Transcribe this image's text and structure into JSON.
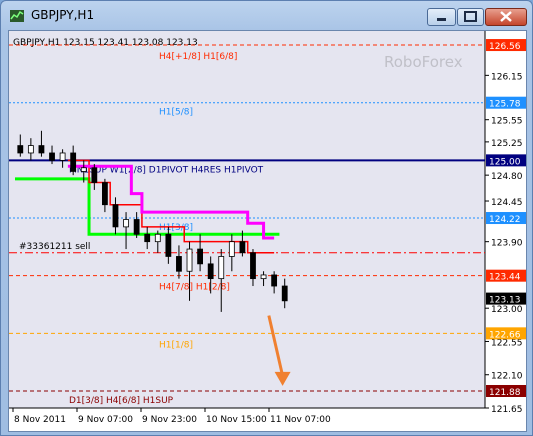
{
  "window": {
    "title": "GBPJPY,H1"
  },
  "chart": {
    "header": "GBPJPY,H1  123.15 123.41 123.08 123.13",
    "watermark": "RoboForex",
    "colors": {
      "background": "#e5e5f0",
      "candles": "#000000",
      "green_line": "#00ff00",
      "magenta_line": "#ff00ff",
      "red_line": "#ff0000",
      "arrow": "#f08030"
    }
  },
  "chart_data": {
    "type": "candlestick",
    "symbol": "GBPJPY",
    "timeframe": "H1",
    "ohlc_last": {
      "open": 123.15,
      "high": 123.41,
      "low": 123.08,
      "close": 123.13
    },
    "ylim": [
      121.65,
      126.75
    ],
    "y_ticks": [
      "126.15",
      "125.55",
      "125.25",
      "124.80",
      "124.45",
      "123.90",
      "123.00",
      "122.55",
      "122.10",
      "121.65"
    ],
    "x_ticks": [
      "8 Nov 2011",
      "9 Nov 07:00",
      "9 Nov 23:00",
      "10 Nov 15:00",
      "11 Nov 07:00"
    ],
    "levels": [
      {
        "label": "H4[+1/8] H1[6/8]",
        "price": 126.56,
        "price_label": "126.56",
        "color": "#ff2a00",
        "style": "dashed"
      },
      {
        "label": "H1[5/8]",
        "price": 125.78,
        "price_label": "125.78",
        "color": "#1e90ff",
        "style": "dotted"
      },
      {
        "label": "MN1SUP W1[2/8] D1PIVOT H4RES H1PIVOT",
        "price": 125.0,
        "price_label": "125.00",
        "color": "#000080",
        "style": "solid"
      },
      {
        "label": "H1[3/8]",
        "price": 124.22,
        "price_label": "124.22",
        "color": "#1e90ff",
        "style": "dotted"
      },
      {
        "label": "H4[7/8] H1[2/8]",
        "price": 123.44,
        "price_label": "123.44",
        "color": "#ff2a00",
        "style": "dashed"
      },
      {
        "label": "H1[1/8]",
        "price": 122.66,
        "price_label": "122.66",
        "color": "#ffa500",
        "style": "dashed"
      },
      {
        "label": "D1[3/8] H4[6/8] H1SUP",
        "price": 121.88,
        "price_label": "121.88",
        "color": "#8b0000",
        "style": "dashed"
      }
    ],
    "current_price": {
      "price": 123.13,
      "price_label": "123.13"
    },
    "order": {
      "label": "#33361211 sell",
      "price": 123.75
    },
    "green_line": [
      [
        0,
        124.75
      ],
      [
        7,
        124.75
      ],
      [
        7,
        124.0
      ],
      [
        25,
        124.0
      ]
    ],
    "magenta_line": [
      [
        5,
        124.92
      ],
      [
        11,
        124.92
      ],
      [
        11,
        124.55
      ],
      [
        12,
        124.55
      ],
      [
        12,
        124.3
      ],
      [
        22,
        124.3
      ],
      [
        22,
        124.15
      ],
      [
        23.5,
        124.15
      ],
      [
        23.5,
        123.95
      ],
      [
        24.5,
        123.95
      ]
    ],
    "red_line": [
      [
        5,
        125.0
      ],
      [
        7,
        125.0
      ],
      [
        7,
        124.7
      ],
      [
        9,
        124.7
      ],
      [
        9,
        124.4
      ],
      [
        12,
        124.4
      ],
      [
        12,
        124.1
      ],
      [
        16,
        124.1
      ],
      [
        16,
        123.9
      ],
      [
        22,
        123.9
      ],
      [
        22,
        123.75
      ],
      [
        24.5,
        123.75
      ]
    ],
    "candles": [
      [
        125.2,
        125.35,
        125.05,
        125.1
      ],
      [
        125.1,
        125.3,
        125.0,
        125.2
      ],
      [
        125.2,
        125.4,
        125.05,
        125.1
      ],
      [
        125.1,
        125.2,
        124.95,
        125.0
      ],
      [
        125.0,
        125.15,
        124.9,
        125.1
      ],
      [
        125.1,
        125.2,
        124.8,
        124.85
      ],
      [
        124.85,
        125.0,
        124.7,
        124.9
      ],
      [
        124.9,
        124.95,
        124.6,
        124.7
      ],
      [
        124.7,
        124.75,
        124.3,
        124.4
      ],
      [
        124.4,
        124.5,
        124.0,
        124.1
      ],
      [
        124.1,
        124.3,
        123.8,
        124.2
      ],
      [
        124.2,
        124.3,
        123.95,
        124.0
      ],
      [
        124.0,
        124.1,
        123.8,
        123.9
      ],
      [
        123.9,
        124.05,
        123.75,
        124.0
      ],
      [
        124.0,
        124.1,
        123.6,
        123.7
      ],
      [
        123.7,
        123.85,
        123.4,
        123.5
      ],
      [
        123.5,
        123.9,
        123.1,
        123.8
      ],
      [
        123.8,
        124.0,
        123.5,
        123.6
      ],
      [
        123.6,
        123.7,
        123.2,
        123.4
      ],
      [
        123.4,
        123.8,
        122.95,
        123.7
      ],
      [
        123.7,
        124.0,
        123.5,
        123.9
      ],
      [
        123.9,
        124.05,
        123.7,
        123.75
      ],
      [
        123.75,
        123.8,
        123.3,
        123.4
      ],
      [
        123.4,
        123.5,
        123.3,
        123.45
      ],
      [
        123.45,
        123.5,
        123.2,
        123.3
      ],
      [
        123.3,
        123.4,
        123.0,
        123.1
      ]
    ],
    "arrow": {
      "from": [
        24,
        122.9
      ],
      "to": [
        25.3,
        121.95
      ]
    }
  }
}
